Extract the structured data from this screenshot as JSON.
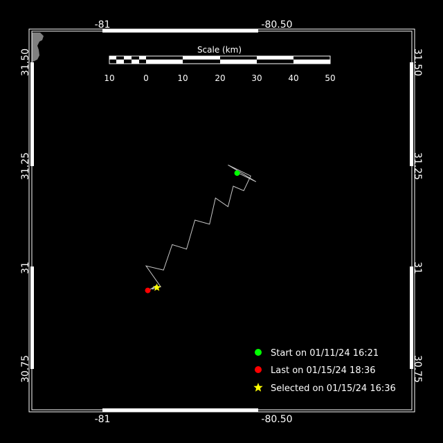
{
  "map": {
    "lon_range": [
      -81.22,
      -80.25
    ],
    "lat_range": [
      30.67,
      31.59
    ],
    "lon_ticks": [
      "-81",
      "-80.50"
    ],
    "lat_ticks": [
      "31.50",
      "31.25",
      "31",
      "30.75"
    ],
    "colors": {
      "background": "#000000",
      "frame": "#ffffff",
      "track": "#c8c8c8",
      "start": "#00ff00",
      "last": "#ff0000",
      "selected": "#ffff00",
      "land": "#808080"
    },
    "track": [
      [
        -80.615,
        31.231
      ],
      [
        -80.56,
        31.208
      ],
      [
        -80.64,
        31.249
      ],
      [
        -80.575,
        31.222
      ],
      [
        -80.595,
        31.186
      ],
      [
        -80.625,
        31.197
      ],
      [
        -80.64,
        31.147
      ],
      [
        -80.676,
        31.168
      ],
      [
        -80.693,
        31.104
      ],
      [
        -80.735,
        31.114
      ],
      [
        -80.759,
        31.043
      ],
      [
        -80.8,
        31.054
      ],
      [
        -80.825,
        30.992
      ],
      [
        -80.875,
        31.002
      ],
      [
        -80.833,
        30.951
      ],
      [
        -80.858,
        30.945
      ],
      [
        -80.844,
        30.955
      ],
      [
        -80.87,
        30.941
      ]
    ],
    "start": {
      "lon": -80.614,
      "lat": 31.229
    },
    "last": {
      "lon": -80.87,
      "lat": 30.942
    },
    "selected": {
      "lon": -80.844,
      "lat": 30.949
    }
  },
  "scale": {
    "title": "Scale (km)",
    "labels": [
      "10",
      "0",
      "10",
      "20",
      "30",
      "40",
      "50"
    ]
  },
  "legend": {
    "start": "Start on 01/11/24 16:21",
    "last": "Last on 01/15/24 18:36",
    "selected": "Selected on 01/15/24 16:36"
  }
}
